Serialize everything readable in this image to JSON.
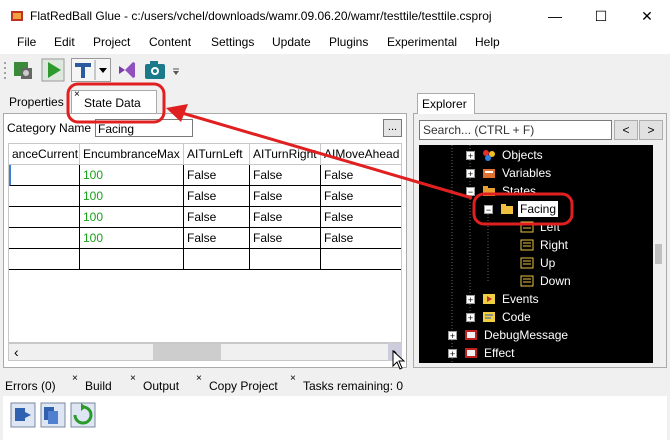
{
  "window": {
    "title": "FlatRedBall Glue - c:/users/vchel/downloads/wamr.09.06.20/wamr/testtile/testtile.csproj",
    "minimize": "—",
    "maximize": "☐",
    "close": "✕"
  },
  "menu": [
    "File",
    "Edit",
    "Project",
    "Content",
    "Settings",
    "Update",
    "Plugins",
    "Experimental",
    "Help"
  ],
  "left_tabs": {
    "properties": "Properties",
    "state_data": "State Data",
    "close_glyph": "×"
  },
  "category": {
    "label": "Category Name",
    "value": "Facing",
    "browse": "..."
  },
  "grid": {
    "columns": [
      "anceCurrent",
      "EncumbranceMax",
      "AITurnLeft",
      "AITurnRight",
      "AIMoveAhead"
    ],
    "rows": [
      [
        "",
        "100",
        "False",
        "False",
        "False"
      ],
      [
        "",
        "100",
        "False",
        "False",
        "False"
      ],
      [
        "",
        "100",
        "False",
        "False",
        "False"
      ],
      [
        "",
        "100",
        "False",
        "False",
        "False"
      ],
      [
        "",
        "",
        "",
        "",
        ""
      ]
    ],
    "scroll_left": "‹",
    "scroll_right": "›"
  },
  "explorer": {
    "tab": "Explorer",
    "search_placeholder": "Search... (CTRL + F)",
    "back": "<",
    "forward": ">",
    "tree": [
      {
        "label": "Objects",
        "icon": "objects-icon",
        "expander": "+",
        "indent": 1
      },
      {
        "label": "Variables",
        "icon": "variables-icon",
        "expander": "+",
        "indent": 1
      },
      {
        "label": "States",
        "icon": "folder-icon",
        "expander": "−",
        "indent": 1
      },
      {
        "label": "Facing",
        "icon": "folder-icon",
        "expander": "−",
        "indent": 2,
        "selected": true
      },
      {
        "label": "Left",
        "icon": "state-icon",
        "expander": "",
        "indent": 3
      },
      {
        "label": "Right",
        "icon": "state-icon",
        "expander": "",
        "indent": 3
      },
      {
        "label": "Up",
        "icon": "state-icon",
        "expander": "",
        "indent": 3
      },
      {
        "label": "Down",
        "icon": "state-icon",
        "expander": "",
        "indent": 3
      },
      {
        "label": "Events",
        "icon": "events-icon",
        "expander": "+",
        "indent": 1
      },
      {
        "label": "Code",
        "icon": "code-icon",
        "expander": "+",
        "indent": 1
      },
      {
        "label": "DebugMessage",
        "icon": "entity-icon",
        "expander": "+",
        "indent": 0
      },
      {
        "label": "Effect",
        "icon": "entity-icon",
        "expander": "+",
        "indent": 0
      }
    ]
  },
  "bottom_tabs": [
    "Errors (0)",
    "Build",
    "Output",
    "Copy Project",
    "Tasks remaining: 0"
  ],
  "colors": {
    "annotation": "#e02020",
    "tree_bg": "#000000",
    "value_green": "#1aa01a"
  }
}
